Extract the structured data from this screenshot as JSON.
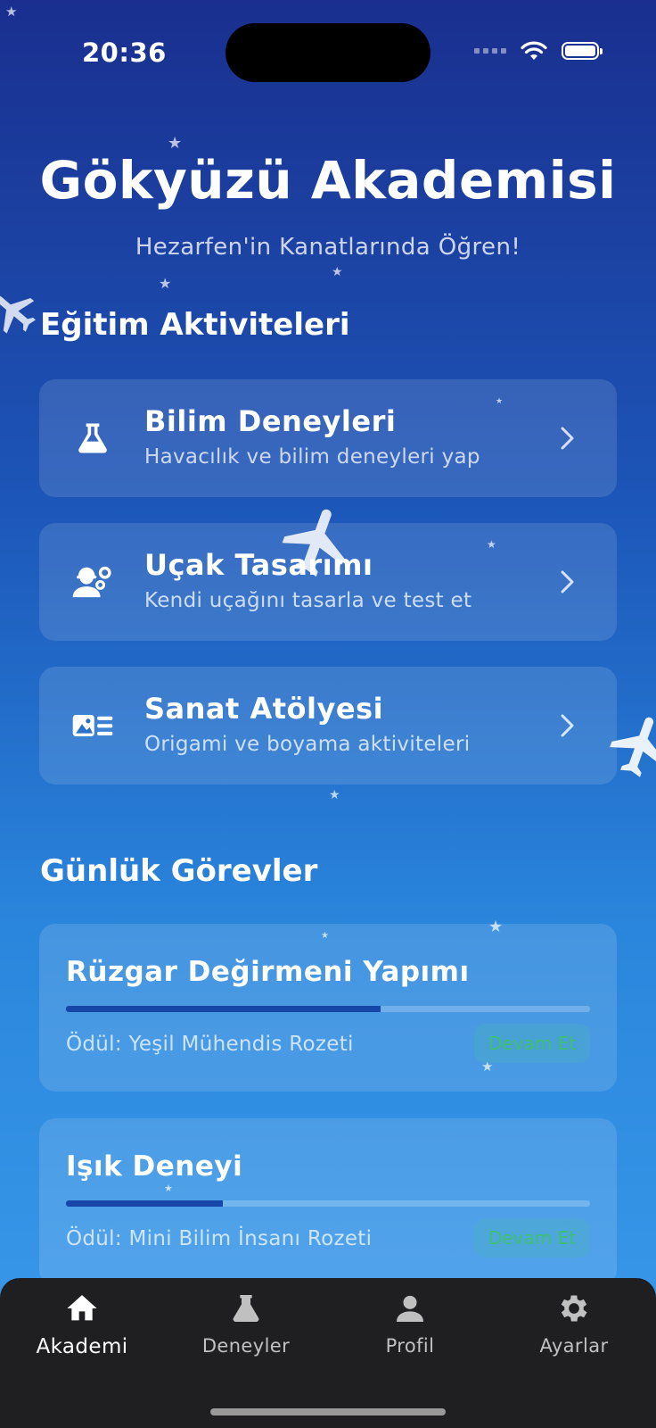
{
  "status_bar": {
    "time": "20:36"
  },
  "header": {
    "title": "Gökyüzü Akademisi",
    "subtitle": "Hezarfen'in Kanatlarında Öğren!"
  },
  "activities_section": {
    "title": "Eğitim Aktiviteleri",
    "items": [
      {
        "title": "Bilim Deneyleri",
        "description": "Havacılık ve bilim deneyleri yap",
        "icon": "flask-icon"
      },
      {
        "title": "Uçak Tasarımı",
        "description": "Kendi uçağını tasarla ve test et",
        "icon": "engineer-icon"
      },
      {
        "title": "Sanat Atölyesi",
        "description": "Origami ve boyama aktiviteleri",
        "icon": "image-list-icon"
      }
    ]
  },
  "tasks_section": {
    "title": "Günlük Görevler",
    "items": [
      {
        "title": "Rüzgar Değirmeni Yapımı",
        "reward": "Ödül: Yeşil Mühendis Rozeti",
        "button": "Devam Et",
        "progress": 0.6
      },
      {
        "title": "Işık Deneyi",
        "reward": "Ödül: Mini Bilim İnsanı Rozeti",
        "button": "Devam Et",
        "progress": 0.3
      }
    ]
  },
  "tab_bar": {
    "active": "Akademi",
    "items": [
      {
        "label": "Akademi",
        "icon": "home-icon"
      },
      {
        "label": "Deneyler",
        "icon": "flask-icon"
      },
      {
        "label": "Profil",
        "icon": "person-icon"
      },
      {
        "label": "Ayarlar",
        "icon": "gear-icon"
      }
    ]
  },
  "colors": {
    "background_top": "#1a2f8f",
    "background_bottom": "#3c9cec",
    "progress_fill": "#1646a8",
    "continue_text": "#3fbf72",
    "tab_bar": "#1f1f22"
  }
}
